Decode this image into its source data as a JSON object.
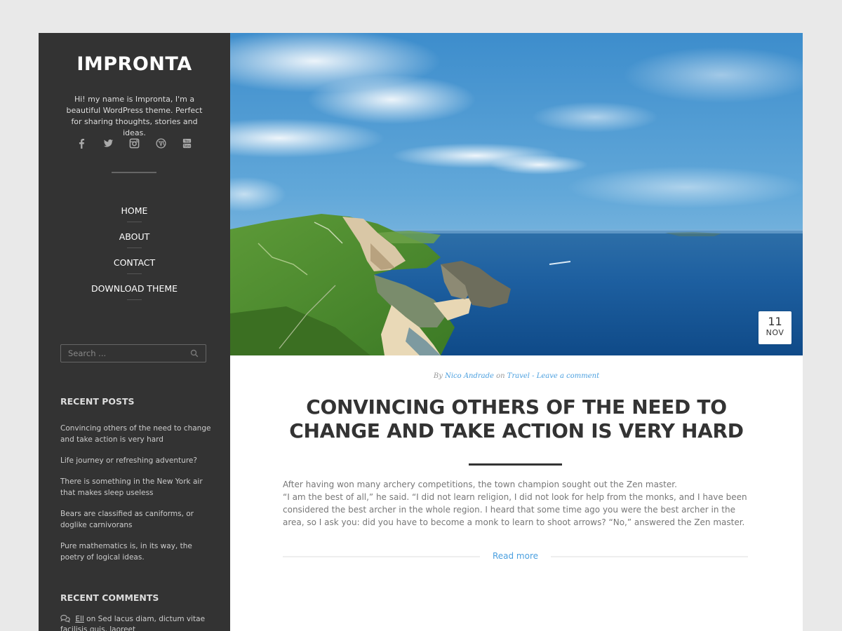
{
  "site": {
    "title": "IMPRONTA",
    "description": "Hi! my name is Impronta, I'm a beautiful WordPress theme. Perfect for sharing thoughts, stories and ideas.",
    "social_icons": [
      "facebook-icon",
      "twitter-icon",
      "instagram-icon",
      "wordpress-icon",
      "youtube-icon"
    ]
  },
  "nav": {
    "items": [
      {
        "label": "HOME"
      },
      {
        "label": "ABOUT"
      },
      {
        "label": "CONTACT"
      },
      {
        "label": "DOWNLOAD THEME"
      }
    ]
  },
  "search": {
    "placeholder": "Search ..."
  },
  "recent_posts": {
    "title": "RECENT POSTS",
    "items": [
      {
        "label": "Convincing others of the need to change and take action is very hard"
      },
      {
        "label": "Life journey or refreshing adventure?"
      },
      {
        "label": "There is something in the New York air that makes sleep useless"
      },
      {
        "label": "Bears are classified as caniforms, or doglike carnivorans"
      },
      {
        "label": "Pure mathematics is, in its way, the poetry of logical ideas."
      }
    ]
  },
  "recent_comments": {
    "title": "RECENT COMMENTS",
    "items": [
      {
        "author": "Ell",
        "on": "on",
        "post": "Sed lacus diam, dictum vitae facilisis quis, laoreet"
      }
    ]
  },
  "post": {
    "date_day": "11",
    "date_month": "NOV",
    "meta_by": "By",
    "author": "Nico Andrade",
    "meta_on": "on",
    "category": "Travel",
    "meta_sep": " - ",
    "comment_link": "Leave a comment",
    "title": "CONVINCING OTHERS OF THE NEED TO CHANGE AND TAKE ACTION IS VERY HARD",
    "excerpt_1": "After having won many archery competitions, the town champion sought out the Zen master.",
    "excerpt_2": "“I am the best of all,” he said. “I did not learn religion, I did not look for help from the monks, and I have been considered the best archer in the whole region. I heard that some time ago you were the best archer in the area, so I ask you: did you have to become a monk to learn to shoot arrows? “No,” answered the Zen master.",
    "read_more": "Read more"
  },
  "colors": {
    "sidebar_bg": "#333333",
    "page_bg": "#e9e9e9",
    "accent": "#4a9fdf",
    "title_text": "#333333"
  }
}
